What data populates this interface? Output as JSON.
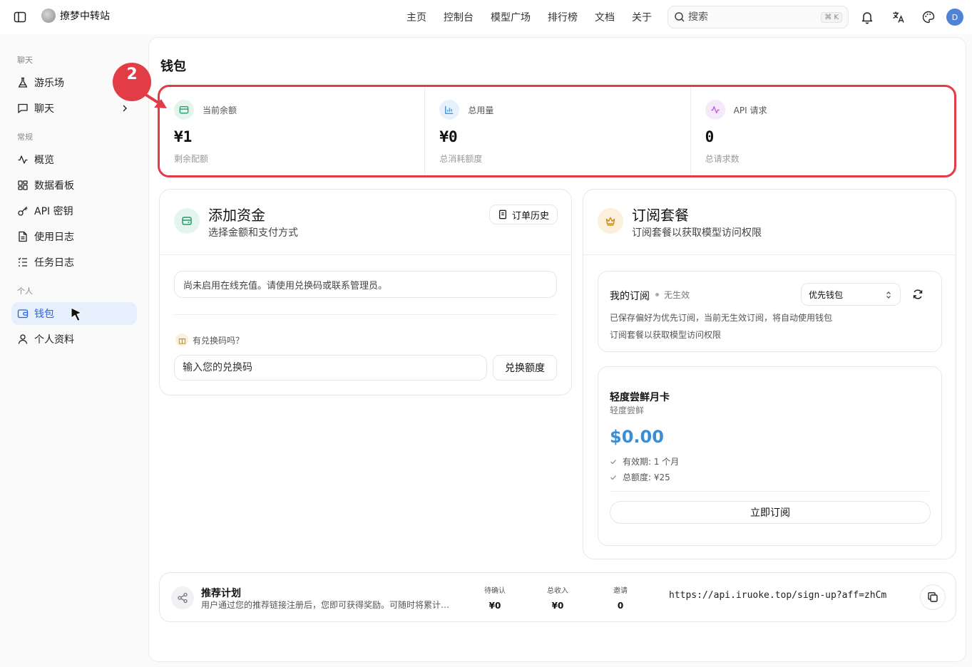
{
  "header": {
    "brand": "撩梦中转站",
    "nav": [
      "主页",
      "控制台",
      "模型广场",
      "排行榜",
      "文档",
      "关于"
    ],
    "search_placeholder": "搜索",
    "search_shortcut": "⌘ K",
    "avatar_initial": "D"
  },
  "sidebar": {
    "sections": [
      {
        "label": "聊天",
        "items": [
          {
            "label": "游乐场",
            "icon": "flask-icon"
          },
          {
            "label": "聊天",
            "icon": "chat-icon"
          }
        ]
      },
      {
        "label": "常规",
        "items": [
          {
            "label": "概览",
            "icon": "activity-icon"
          },
          {
            "label": "数据看板",
            "icon": "dashboard-icon"
          },
          {
            "label": "API 密钥",
            "icon": "key-icon"
          },
          {
            "label": "使用日志",
            "icon": "file-icon"
          },
          {
            "label": "任务日志",
            "icon": "list-icon"
          }
        ]
      },
      {
        "label": "个人",
        "items": [
          {
            "label": "钱包",
            "icon": "wallet-icon",
            "active": true
          },
          {
            "label": "个人资料",
            "icon": "user-icon"
          }
        ]
      }
    ]
  },
  "page": {
    "title": "钱包",
    "step_number": "2"
  },
  "stats": [
    {
      "label": "当前余额",
      "value": "¥1",
      "sub": "剩余配额",
      "icon": "wallet-icon",
      "color": "#1f9d6b"
    },
    {
      "label": "总用量",
      "value": "¥0",
      "sub": "总消耗额度",
      "icon": "bar-chart-icon",
      "color": "#3a8ed6"
    },
    {
      "label": "API 请求",
      "value": "0",
      "sub": "总请求数",
      "icon": "activity-icon",
      "color": "#c05ad6"
    }
  ],
  "add_funds": {
    "title": "添加资金",
    "subtitle": "选择金额和支付方式",
    "history_button": "订单历史",
    "notice": "尚未启用在线充值。请使用兑换码或联系管理员。",
    "redeem_label": "有兑换码吗？",
    "redeem_placeholder": "输入您的兑换码",
    "redeem_button": "兑换额度"
  },
  "subscription": {
    "title": "订阅套餐",
    "subtitle": "订阅套餐以获取模型访问权限",
    "my_sub_label": "我的订阅",
    "status": "无生效",
    "select_value": "优先钱包",
    "desc_line1": "已保存偏好为优先订阅，当前无生效订阅，将自动使用钱包",
    "desc_line2": "订阅套餐以获取模型访问权限",
    "plan": {
      "title": "轻度尝鲜月卡",
      "subtitle": "轻度尝鲜",
      "price": "$0.00",
      "features": [
        "有效期: 1 个月",
        "总额度: ¥25"
      ],
      "button": "立即订阅"
    }
  },
  "referral": {
    "title": "推荐计划",
    "desc": "用户通过您的推荐链接注册后，您即可获得奖励。可随时将累计奖励转入余额",
    "stats": [
      {
        "label": "待确认",
        "value": "¥0"
      },
      {
        "label": "总收入",
        "value": "¥0"
      },
      {
        "label": "邀请",
        "value": "0"
      }
    ],
    "link": "https://api.iruoke.top/sign-up?aff=zhCm"
  }
}
